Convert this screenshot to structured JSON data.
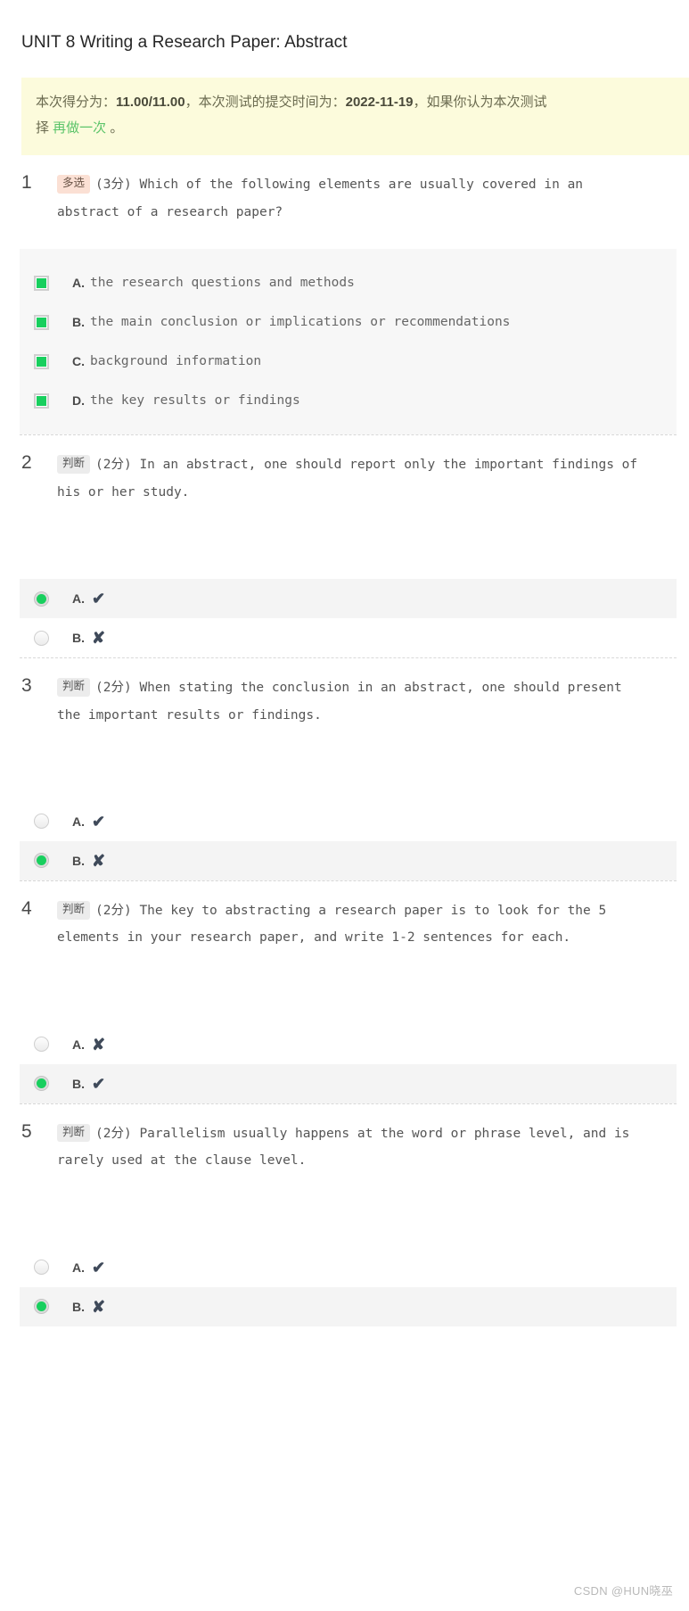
{
  "page_title": "UNIT 8 Writing a Research Paper: Abstract",
  "notice": {
    "prefix": "本次得分为：",
    "score": "11.00/11.00",
    "mid": "，本次测试的提交时间为：",
    "date": "2022-11-19",
    "suffix": "，如果你认为本次测试",
    "line2_prefix": "择 ",
    "retry_link": "再做一次",
    "line2_suffix": " 。"
  },
  "colors": {
    "notice_bg": "#fcfbdc",
    "accent_green": "#18cf5e",
    "retry_link": "#5cc46a",
    "badge_multi_bg": "#fbe0d4",
    "badge_judge_bg": "#ececec",
    "option_panel_bg": "#f7f7f7",
    "row_highlight_bg": "#f4f4f4"
  },
  "questions": [
    {
      "number": "1",
      "type_badge": "多选",
      "badge_style": "multi",
      "score": "(3分)",
      "text_line1": "Which of the following elements are usually covered in an",
      "text_line2": "abstract of a research paper?",
      "input_type": "checkbox",
      "options": [
        {
          "letter": "A.",
          "text": "the research questions and methods",
          "checked": true
        },
        {
          "letter": "B.",
          "text": "the main conclusion or implications or recommendations",
          "checked": true
        },
        {
          "letter": "C.",
          "text": "background information",
          "checked": true
        },
        {
          "letter": "D.",
          "text": "the key results or findings",
          "checked": true
        }
      ]
    },
    {
      "number": "2",
      "type_badge": "判断",
      "badge_style": "judge",
      "score": "(2分)",
      "text_line1": "In an abstract, one should report only the important findings of",
      "text_line2": "his or her study.",
      "input_type": "radio",
      "options": [
        {
          "letter": "A.",
          "glyph": "✔",
          "checked": true
        },
        {
          "letter": "B.",
          "glyph": "✘",
          "checked": false
        }
      ]
    },
    {
      "number": "3",
      "type_badge": "判断",
      "badge_style": "judge",
      "score": "(2分)",
      "text_line1": "When stating the conclusion in an abstract, one should present",
      "text_line2": "the important results or findings.",
      "input_type": "radio",
      "options": [
        {
          "letter": "A.",
          "glyph": "✔",
          "checked": false
        },
        {
          "letter": "B.",
          "glyph": "✘",
          "checked": true
        }
      ]
    },
    {
      "number": "4",
      "type_badge": "判断",
      "badge_style": "judge",
      "score": "(2分)",
      "text_line1": "The key to abstracting a research paper is to look for the 5",
      "text_line2": "elements in your research paper, and write 1-2 sentences for each.",
      "input_type": "radio",
      "options": [
        {
          "letter": "A.",
          "glyph": "✘",
          "checked": false
        },
        {
          "letter": "B.",
          "glyph": "✔",
          "checked": true
        }
      ]
    },
    {
      "number": "5",
      "type_badge": "判断",
      "badge_style": "judge",
      "score": "(2分)",
      "text_line1": "Parallelism usually happens at the word or phrase level, and is",
      "text_line2": "rarely used at the clause level.",
      "input_type": "radio",
      "options": [
        {
          "letter": "A.",
          "glyph": "✔",
          "checked": false
        },
        {
          "letter": "B.",
          "glyph": "✘",
          "checked": true
        }
      ]
    }
  ],
  "watermark": "CSDN @HUN晓巫"
}
